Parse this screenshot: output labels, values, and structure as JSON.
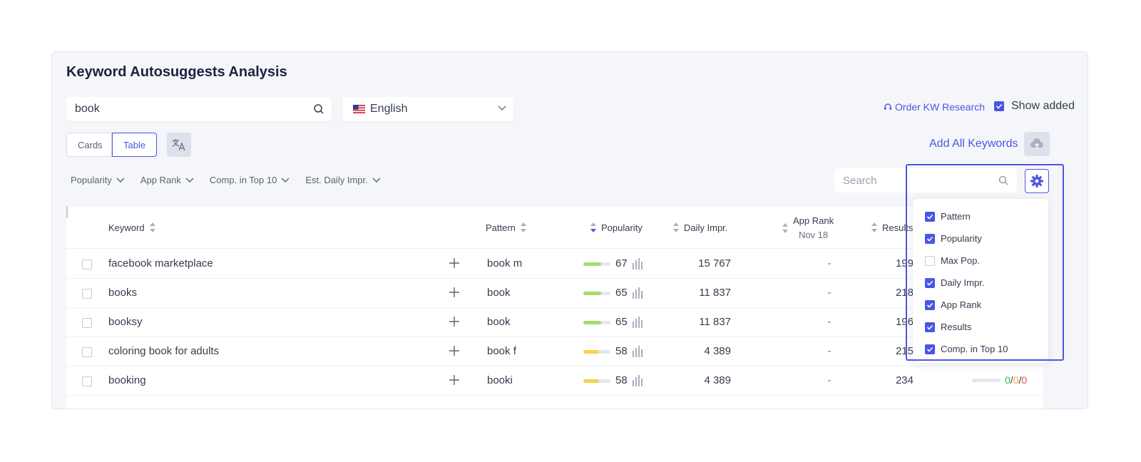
{
  "panel": {
    "title": "Keyword Autosuggests Analysis"
  },
  "search": {
    "value": "book"
  },
  "language": {
    "flag": "us-flag",
    "value": "English"
  },
  "header_actions": {
    "order_link": "Order KW Research",
    "show_added": "Show added",
    "show_added_checked": true
  },
  "view_toggle": {
    "cards": "Cards",
    "table": "Table",
    "selected": "Table"
  },
  "add_all": "Add All Keywords",
  "filters": [
    "Popularity",
    "App Rank",
    "Comp. in Top 10",
    "Est. Daily Impr."
  ],
  "table_search": {
    "placeholder": "Search"
  },
  "columns": {
    "keyword": "Keyword",
    "pattern": "Pattern",
    "popularity": "Popularity",
    "daily_impr": "Daily Impr.",
    "app_rank": "App Rank",
    "app_rank_date": "Nov 18",
    "results": "Results"
  },
  "rows": [
    {
      "keyword": "facebook marketplace",
      "pattern": "book m",
      "popularity": 67,
      "pop_color": "#a8dc6a",
      "daily_impr": "15 767",
      "app_rank": "-",
      "results": "199"
    },
    {
      "keyword": "books",
      "pattern": "book",
      "popularity": 65,
      "pop_color": "#a8dc6a",
      "daily_impr": "11 837",
      "app_rank": "-",
      "results": "218"
    },
    {
      "keyword": "booksy",
      "pattern": "book",
      "popularity": 65,
      "pop_color": "#a8dc6a",
      "daily_impr": "11 837",
      "app_rank": "-",
      "results": "196"
    },
    {
      "keyword": "coloring book for adults",
      "pattern": "book f",
      "popularity": 58,
      "pop_color": "#f6d44a",
      "daily_impr": "4 389",
      "app_rank": "-",
      "results": "215"
    },
    {
      "keyword": "booking",
      "pattern": "booki",
      "popularity": 58,
      "pop_color": "#f6d44a",
      "daily_impr": "4 389",
      "app_rank": "-",
      "results": "234",
      "comp": [
        "0",
        "0",
        "0"
      ]
    }
  ],
  "column_menu": [
    {
      "label": "Pattern",
      "checked": true
    },
    {
      "label": "Popularity",
      "checked": true
    },
    {
      "label": "Max Pop.",
      "checked": false
    },
    {
      "label": "Daily Impr.",
      "checked": true
    },
    {
      "label": "App Rank",
      "checked": true
    },
    {
      "label": "Results",
      "checked": true
    },
    {
      "label": "Comp. in Top 10",
      "checked": true
    }
  ],
  "colors": {
    "accent": "#4a56e2",
    "comp_green": "#3bb54a",
    "comp_orange": "#f0a040",
    "comp_red": "#e0523b"
  }
}
